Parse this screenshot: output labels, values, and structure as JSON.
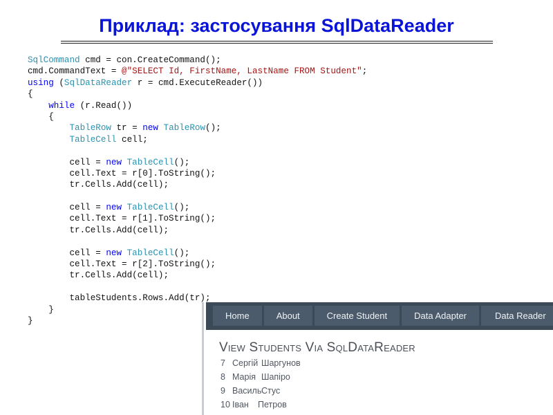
{
  "slide": {
    "title": "Приклад: застосування SqlDataReader"
  },
  "code": {
    "lines": [
      [
        {
          "t": "SqlCommand",
          "c": "tp"
        },
        {
          "t": " cmd = con.CreateCommand();"
        }
      ],
      [
        {
          "t": "cmd.CommandText = "
        },
        {
          "t": "@\"SELECT Id, FirstName, LastName FROM Student\"",
          "c": "str"
        },
        {
          "t": ";"
        }
      ],
      [
        {
          "t": "using",
          "c": "kw"
        },
        {
          "t": " ("
        },
        {
          "t": "SqlDataReader",
          "c": "tp"
        },
        {
          "t": " r = cmd.ExecuteReader())"
        }
      ],
      [
        {
          "t": "{"
        }
      ],
      [
        {
          "t": "    "
        },
        {
          "t": "while",
          "c": "kw"
        },
        {
          "t": " (r.Read())"
        }
      ],
      [
        {
          "t": "    {"
        }
      ],
      [
        {
          "t": "        "
        },
        {
          "t": "TableRow",
          "c": "tp"
        },
        {
          "t": " tr = "
        },
        {
          "t": "new",
          "c": "kw"
        },
        {
          "t": " "
        },
        {
          "t": "TableRow",
          "c": "tp"
        },
        {
          "t": "();"
        }
      ],
      [
        {
          "t": "        "
        },
        {
          "t": "TableCell",
          "c": "tp"
        },
        {
          "t": " cell;"
        }
      ],
      [],
      [
        {
          "t": "        cell = "
        },
        {
          "t": "new",
          "c": "kw"
        },
        {
          "t": " "
        },
        {
          "t": "TableCell",
          "c": "tp"
        },
        {
          "t": "();"
        }
      ],
      [
        {
          "t": "        cell.Text = r[0].ToString();"
        }
      ],
      [
        {
          "t": "        tr.Cells.Add(cell);"
        }
      ],
      [],
      [
        {
          "t": "        cell = "
        },
        {
          "t": "new",
          "c": "kw"
        },
        {
          "t": " "
        },
        {
          "t": "TableCell",
          "c": "tp"
        },
        {
          "t": "();"
        }
      ],
      [
        {
          "t": "        cell.Text = r[1].ToString();"
        }
      ],
      [
        {
          "t": "        tr.Cells.Add(cell);"
        }
      ],
      [],
      [
        {
          "t": "        cell = "
        },
        {
          "t": "new",
          "c": "kw"
        },
        {
          "t": " "
        },
        {
          "t": "TableCell",
          "c": "tp"
        },
        {
          "t": "();"
        }
      ],
      [
        {
          "t": "        cell.Text = r[2].ToString();"
        }
      ],
      [
        {
          "t": "        tr.Cells.Add(cell);"
        }
      ],
      [],
      [
        {
          "t": "        tableStudents.Rows.Add(tr);"
        }
      ],
      [
        {
          "t": "    }"
        }
      ],
      [
        {
          "t": "}"
        }
      ]
    ]
  },
  "web": {
    "nav": [
      "Home",
      "About",
      "Create Student",
      "Data Adapter",
      "Data Reader"
    ],
    "heading": "View Students Via SqlDataReader",
    "students": [
      {
        "id": "7",
        "first": "Сергій",
        "last": "Шаргунов"
      },
      {
        "id": "8",
        "first": "Марія",
        "last": "Шапіро"
      },
      {
        "id": "9",
        "first": "Василь",
        "last": "Стус"
      },
      {
        "id": "10",
        "first": "Іван",
        "last": "Петров"
      }
    ]
  },
  "colors": {
    "title": "#0a14d8",
    "keyword": "#0000ff",
    "type": "#2b91af",
    "string": "#a31515",
    "nav_bar": "#3c4a58",
    "nav_item": "#4c5b6b"
  }
}
